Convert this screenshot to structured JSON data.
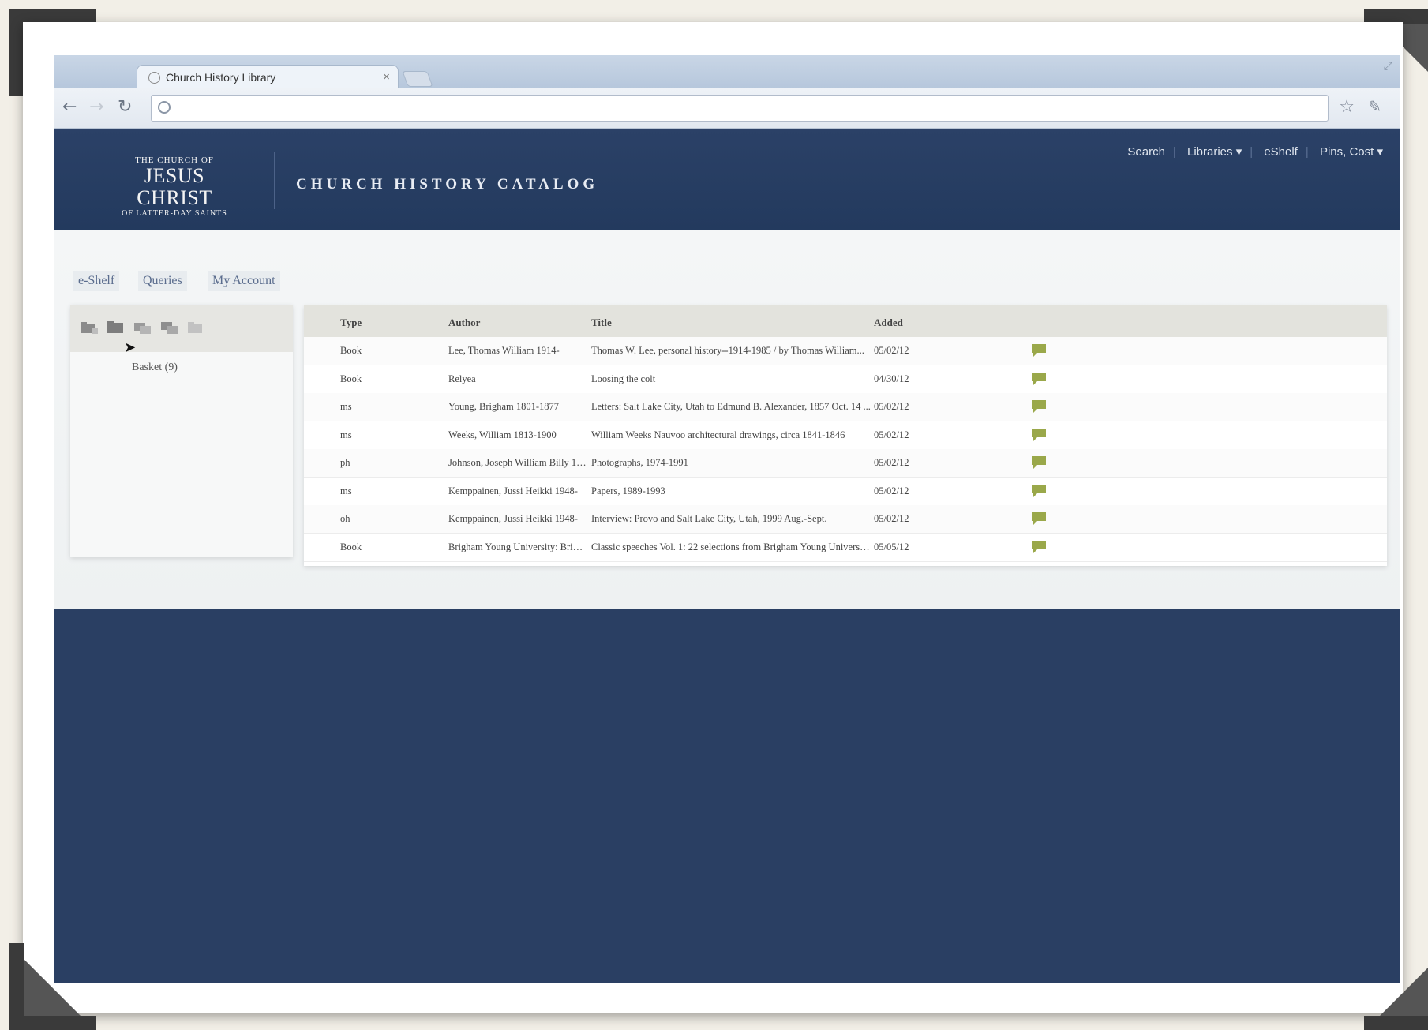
{
  "browser": {
    "tab_title": "Church History Library",
    "tab_close": "×"
  },
  "header": {
    "logo_line1": "THE CHURCH OF",
    "logo_line2": "JESUS CHRIST",
    "logo_line3": "OF LATTER-DAY SAINTS",
    "catalog_title": "CHURCH HISTORY CATALOG",
    "nav": [
      "Search",
      "Libraries ▾",
      "eShelf",
      "Pins, Cost ▾"
    ]
  },
  "content_tabs": [
    "e-Shelf",
    "Queries",
    "My Account"
  ],
  "sidebar": {
    "basket_label": "Basket (9)"
  },
  "table": {
    "headers": [
      "Type",
      "Author",
      "Title",
      "Added"
    ],
    "rows": [
      {
        "type": "Book",
        "author": "Lee, Thomas William 1914-",
        "title": "Thomas W. Lee, personal history--1914-1985 / by Thomas William...",
        "added": "05/02/12"
      },
      {
        "type": "Book",
        "author": "Relyea",
        "title": "Loosing the colt",
        "added": "04/30/12"
      },
      {
        "type": "ms",
        "author": "Young, Brigham 1801-1877",
        "title": "Letters: Salt Lake City, Utah to Edmund B. Alexander, 1857 Oct. 14 ...",
        "added": "05/02/12"
      },
      {
        "type": "ms",
        "author": "Weeks, William 1813-1900",
        "title": "William Weeks Nauvoo architectural drawings, circa 1841-1846",
        "added": "05/02/12"
      },
      {
        "type": "ph",
        "author": "Johnson, Joseph William Billy 19...",
        "title": "Photographs, 1974-1991",
        "added": "05/02/12"
      },
      {
        "type": "ms",
        "author": "Kemppainen, Jussi Heikki 1948-",
        "title": "Papers, 1989-1993",
        "added": "05/02/12"
      },
      {
        "type": "oh",
        "author": "Kemppainen, Jussi Heikki 1948-",
        "title": "Interview: Provo and Salt Lake City, Utah, 1999 Aug.-Sept.",
        "added": "05/02/12"
      },
      {
        "type": "Book",
        "author": "Brigham Young University: Brigh...",
        "title": "Classic speeches Vol. 1: 22 selections from Brigham Young Universit...",
        "added": "05/05/12"
      }
    ]
  },
  "colors": {
    "header_bg": "#2b4167",
    "page_bg": "#2a3f63",
    "bubble": "#9aa84a"
  }
}
